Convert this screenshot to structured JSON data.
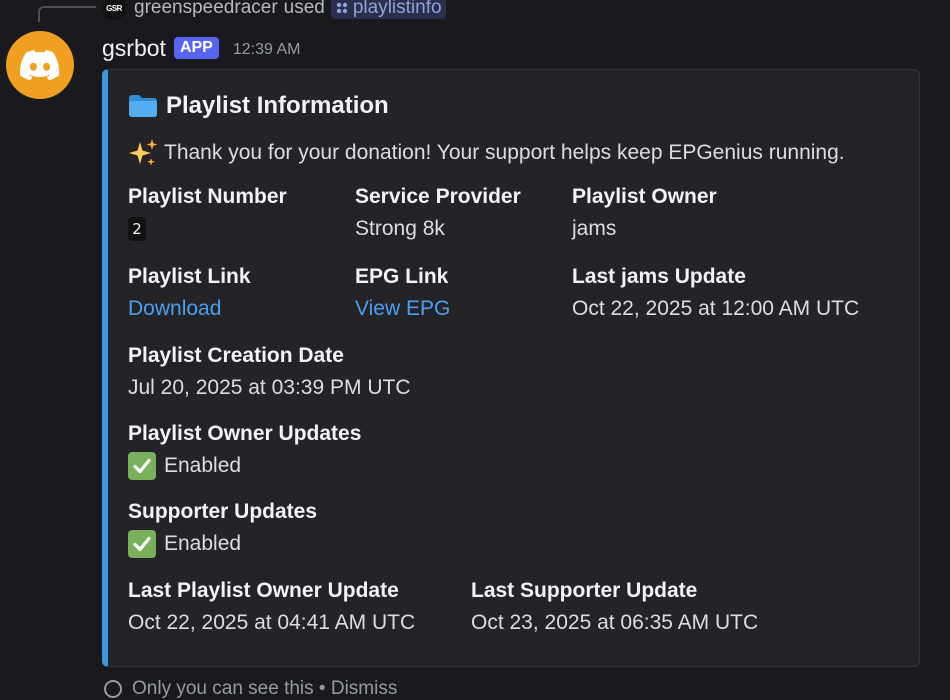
{
  "reply": {
    "mini_avatar_text": "GSR",
    "username": "greenspeedracer",
    "used_text": "used",
    "command": "playlistinfo"
  },
  "message": {
    "username": "gsrbot",
    "badge": "APP",
    "timestamp": "12:39 AM",
    "avatar_icon": "discord-logo-icon",
    "avatar_color": "#f0a020"
  },
  "embed": {
    "accent_color": "#3b99e0",
    "title": "Playlist Information",
    "title_icon": "folder-icon",
    "description": "Thank you for your donation! Your support helps keep EPGenius running.",
    "description_icon": "sparkles-icon",
    "fields": {
      "playlist_number": {
        "name": "Playlist Number",
        "value": "2"
      },
      "service_provider": {
        "name": "Service Provider",
        "value": "Strong 8k"
      },
      "playlist_owner": {
        "name": "Playlist Owner",
        "value": "jams"
      },
      "playlist_link": {
        "name": "Playlist Link",
        "value": "Download"
      },
      "epg_link": {
        "name": "EPG Link",
        "value": "View EPG"
      },
      "last_jams_update": {
        "name": "Last jams Update",
        "value": "Oct 22, 2025 at 12:00 AM UTC"
      },
      "creation_date": {
        "name": "Playlist Creation Date",
        "value": "Jul 20, 2025 at 03:39 PM UTC"
      },
      "owner_updates": {
        "name": "Playlist Owner Updates",
        "value": "Enabled"
      },
      "supporter_updates": {
        "name": "Supporter Updates",
        "value": "Enabled"
      },
      "last_owner_update": {
        "name": "Last Playlist Owner Update",
        "value": "Oct 22, 2025 at 04:41 AM UTC"
      },
      "last_supporter_update": {
        "name": "Last Supporter Update",
        "value": "Oct 23, 2025 at 06:35 AM UTC"
      }
    }
  },
  "footer_hint": "Only you can see this • Dismiss"
}
